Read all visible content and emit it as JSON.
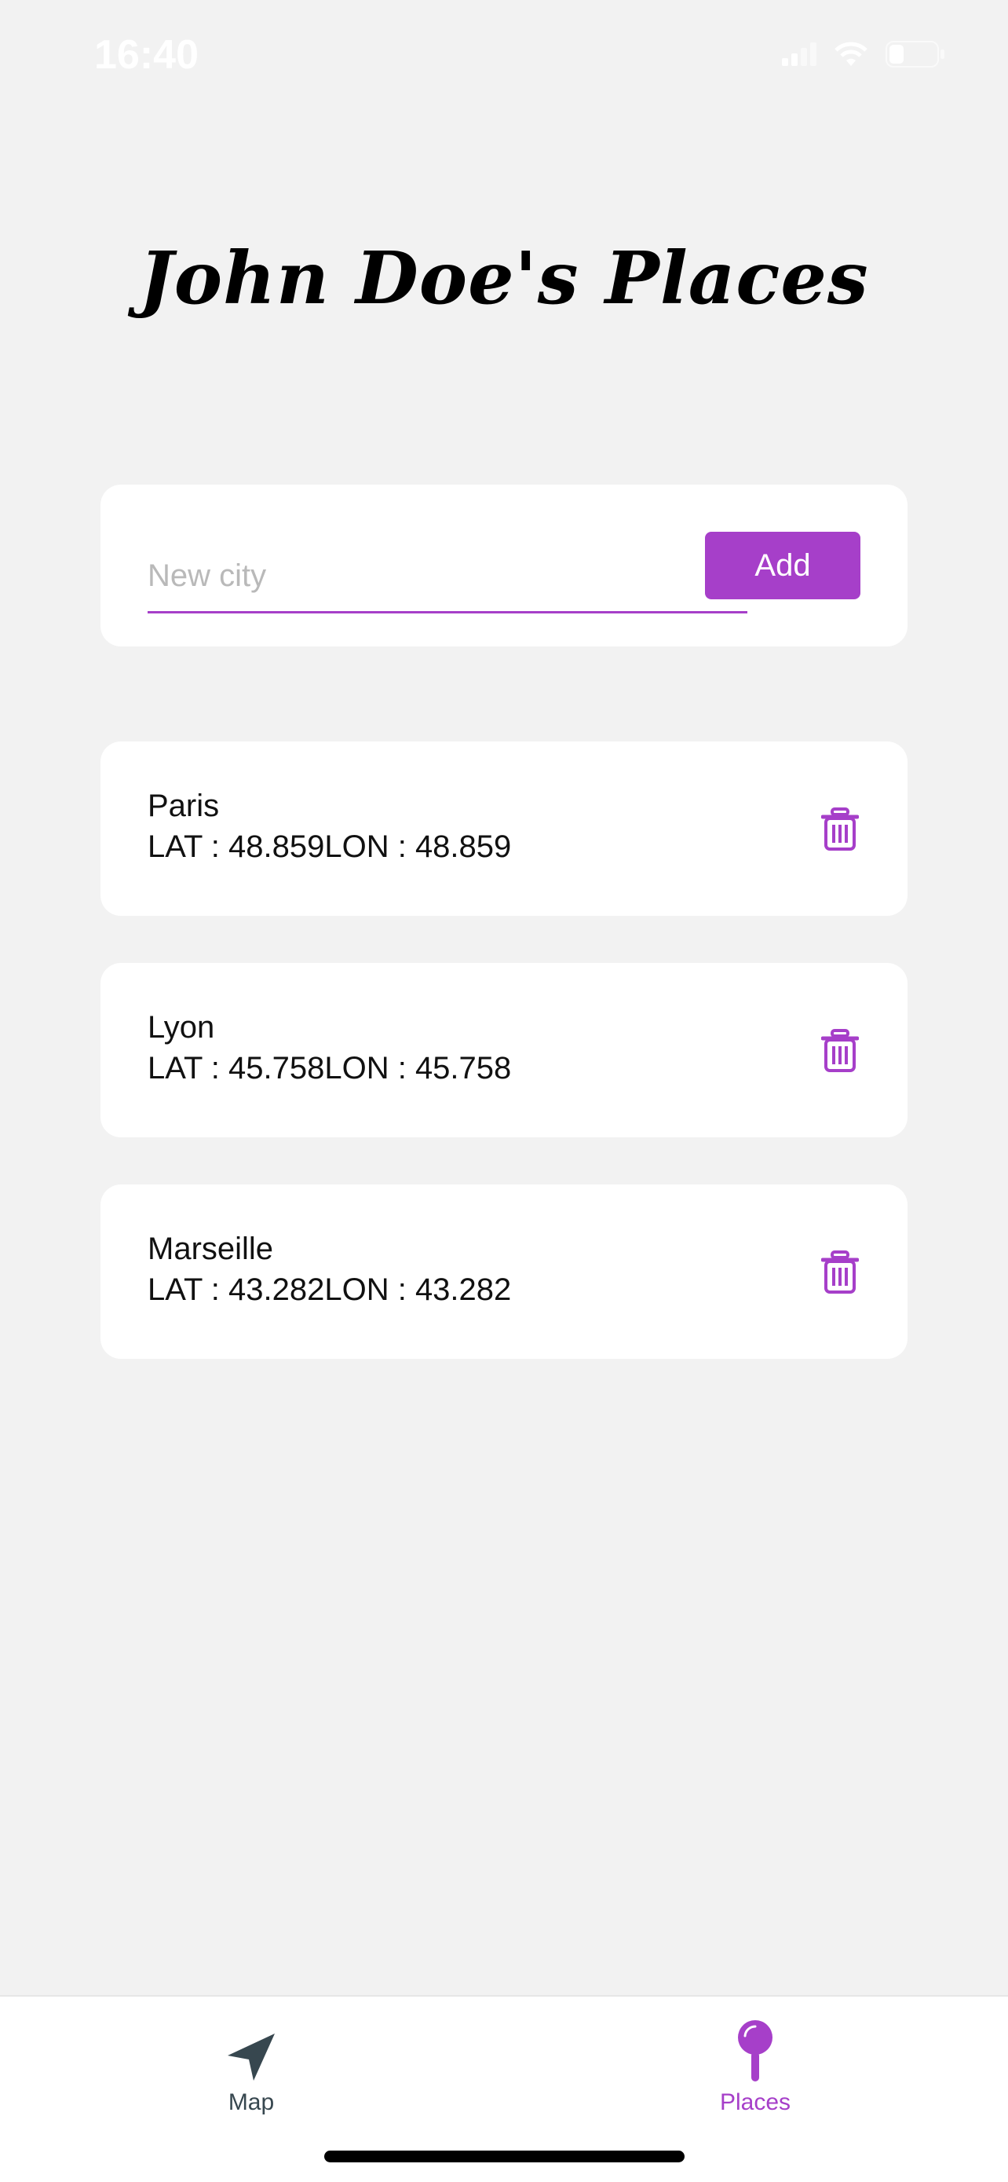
{
  "status_bar": {
    "time": "16:40"
  },
  "title": "John Doe's Places",
  "add_form": {
    "placeholder": "New city",
    "value": "",
    "button_label": "Add"
  },
  "places": [
    {
      "name": "Paris",
      "coords": "LAT : 48.859LON : 48.859"
    },
    {
      "name": "Lyon",
      "coords": "LAT : 45.758LON : 45.758"
    },
    {
      "name": "Marseille",
      "coords": "LAT : 43.282LON : 43.282"
    }
  ],
  "tabs": [
    {
      "label": "Map",
      "icon": "navigation-arrow-icon",
      "active": false
    },
    {
      "label": "Places",
      "icon": "pin-icon",
      "active": true
    }
  ],
  "colors": {
    "accent": "#a63fc9",
    "background": "#f2f2f2",
    "inactive_tab": "#37474f"
  }
}
